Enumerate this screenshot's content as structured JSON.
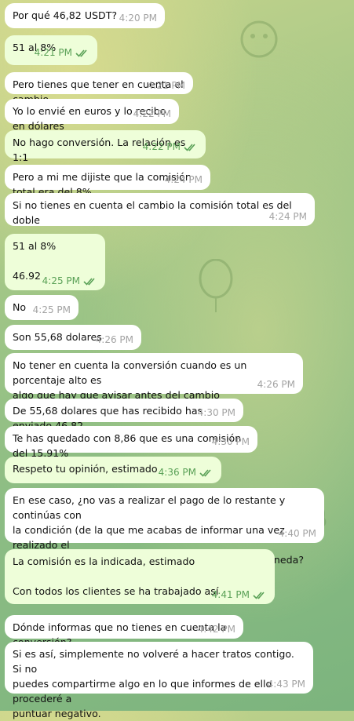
{
  "messages": [
    {
      "dir": "in",
      "lines": [
        "Por qué 46,82 USDT?"
      ],
      "time": "4:20 PM"
    },
    {
      "dir": "out",
      "lines": [
        "51 al 8%"
      ],
      "time": "4:21 PM",
      "read": true
    },
    {
      "dir": "in",
      "lines": [
        "Pero tienes que tener en cuenta el cambio"
      ],
      "time": "4:21 PM"
    },
    {
      "dir": "in",
      "lines": [
        "Yo lo envié en euros y lo recibo en dólares"
      ],
      "time": "4:22 PM"
    },
    {
      "dir": "out",
      "lines": [
        "No hago conversión. La relación es 1:1"
      ],
      "time": "4:22 PM",
      "read": true
    },
    {
      "dir": "in",
      "lines": [
        "Pero a mi me dijiste que la comisión total era del 8%"
      ],
      "time": "4:24 PM"
    },
    {
      "dir": "in",
      "lines": [
        "Si no tienes en cuenta el cambio la comisión total es del doble"
      ],
      "time": "4:24 PM"
    },
    {
      "dir": "out",
      "lines": [
        "51 al 8%",
        "",
        "46.92"
      ],
      "time": "4:25 PM",
      "read": true
    },
    {
      "dir": "in",
      "lines": [
        "No"
      ],
      "time": "4:25 PM"
    },
    {
      "dir": "in",
      "lines": [
        "Son 55,68 dolares"
      ],
      "time": "4:26 PM"
    },
    {
      "dir": "in",
      "lines": [
        "No tener en cuenta la conversión cuando es un porcentaje alto es",
        "algo que hay que avisar antes del cambio"
      ],
      "time": "4:26 PM"
    },
    {
      "dir": "in",
      "lines": [
        "De 55,68 dolares que has recibido has enviado 46,82"
      ],
      "time": "4:30 PM"
    },
    {
      "dir": "in",
      "lines": [
        "Te has quedado con 8,86 que es una comisión del 15,91%"
      ],
      "time": "4:30 PM"
    },
    {
      "dir": "out",
      "lines": [
        "Respeto tu opinión, estimado"
      ],
      "time": "4:36 PM",
      "read": true
    },
    {
      "dir": "in",
      "lines": [
        "En ese caso, ¿no vas a realizar el pago de lo restante y continúas con",
        "la condición (de la que me acabas de informar una vez realizado el",
        "pago) de no tener en cuenta las conversiones de moneda?"
      ],
      "time": "4:40 PM"
    },
    {
      "dir": "out",
      "lines": [
        "La comisión es la indicada, estimado",
        "",
        "Con todos los clientes se ha trabajado así"
      ],
      "time": "4:41 PM",
      "read": true
    },
    {
      "dir": "in",
      "lines": [
        "Dónde informas que no tienes en cuenta la conversión?"
      ],
      "time": "4:42 PM"
    },
    {
      "dir": "in",
      "lines": [
        "Si es así, simplemente no volveré a hacer tratos contigo. Si no",
        "puedes compartirme algo en lo que informes de ello procederé a",
        "puntuar negativo."
      ],
      "time": "4:43 PM"
    }
  ]
}
